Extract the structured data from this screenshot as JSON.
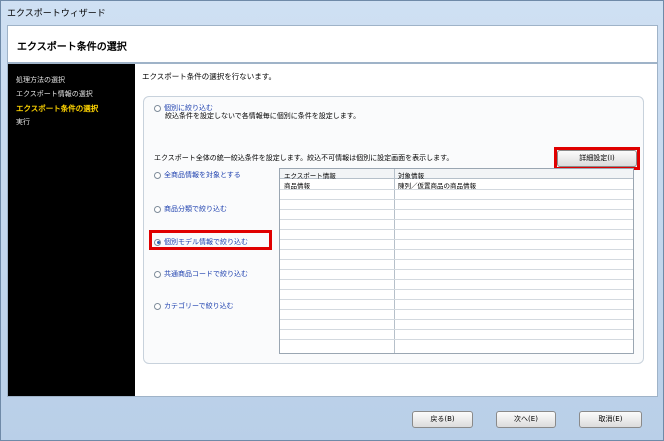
{
  "window": {
    "title": "エクスポートウィザード"
  },
  "header": {
    "heading": "エクスポート条件の選択"
  },
  "sidebar": {
    "steps": [
      {
        "label": "処理方法の選択"
      },
      {
        "label": "エクスポート情報の選択"
      },
      {
        "label": "エクスポート条件の選択"
      },
      {
        "label": "実行"
      }
    ]
  },
  "content": {
    "description": "エクスポート条件の選択を行ないます。",
    "individual_option": {
      "label": "個別に絞り込む",
      "note": "絞込条件を設定しないで各情報毎に個別に条件を設定します。"
    },
    "unified_note": "エクスポート全体の統一絞込条件を設定します。絞込不可情報は個別に設定画面を表示します。",
    "detail_button": "詳細設定(I)",
    "options": [
      {
        "label": "全商品情報を対象とする",
        "selected": false
      },
      {
        "label": "商品分類で絞り込む",
        "selected": false
      },
      {
        "label": "個別モデル情報で絞り込む",
        "selected": true
      },
      {
        "label": "共通商品コードで絞り込む",
        "selected": false
      },
      {
        "label": "カテゴリーで絞り込む",
        "selected": false
      }
    ],
    "table": {
      "columns": [
        "エクスポート情報",
        "対象情報"
      ],
      "rows": [
        [
          "商品情報",
          "陳列／仮置商品の商品情報"
        ]
      ]
    }
  },
  "footer": {
    "back": "戻る(B)",
    "next": "次へ(E)",
    "cancel": "取消(E)"
  },
  "colors": {
    "highlight": "#e00000",
    "active_step": "#ffd400",
    "link": "#1c3fae"
  }
}
